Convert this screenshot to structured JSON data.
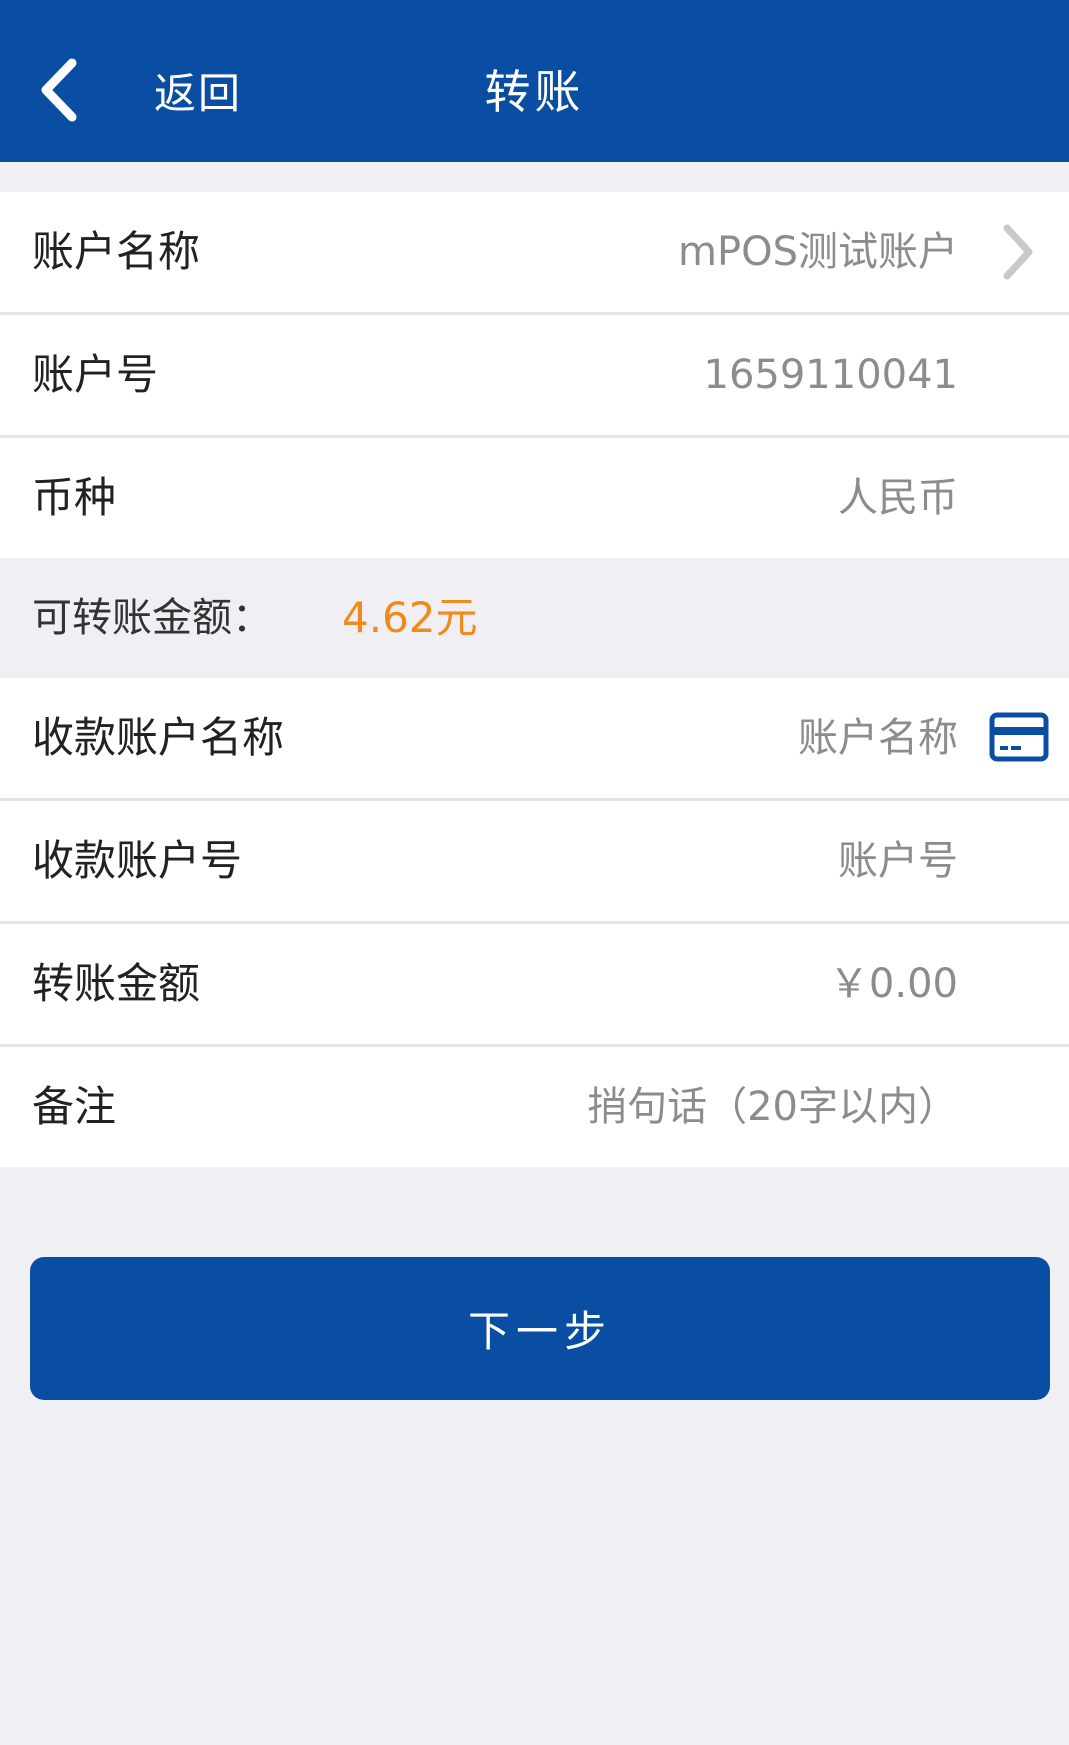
{
  "colors": {
    "header_bg": "#0a4ea3",
    "page_bg": "#efeff4",
    "amount_accent": "#f08a1c",
    "button_bg": "#0a4ea3"
  },
  "header": {
    "back_label": "返回",
    "back_icon": "chevron-left-icon",
    "title": "转账"
  },
  "account": {
    "name_label": "账户名称",
    "name_value": "mPOS测试账户",
    "number_label": "账户号",
    "number_value": "1659110041",
    "currency_label": "币种",
    "currency_value": "人民币"
  },
  "available": {
    "label": "可转账金额：",
    "value": "4.62元"
  },
  "form": {
    "payee_name_label": "收款账户名称",
    "payee_name_placeholder": "账户名称",
    "payee_number_label": "收款账户号",
    "payee_number_placeholder": "账户号",
    "amount_label": "转账金额",
    "amount_placeholder": "￥0.00",
    "note_label": "备注",
    "note_placeholder": "捎句话（20字以内）"
  },
  "actions": {
    "next_label": "下一步"
  }
}
